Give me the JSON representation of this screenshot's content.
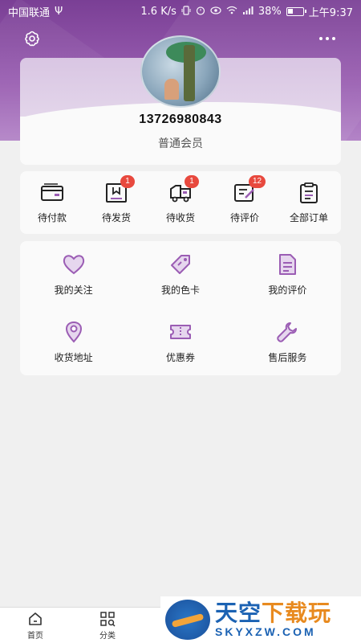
{
  "status_bar": {
    "carrier": "中国联通",
    "usb_symbol": "Ψ",
    "speed": "1.6 K/s",
    "battery_percent": "38%",
    "battery_level": 0.38,
    "time": "上午9:37"
  },
  "profile": {
    "phone": "13726980843",
    "member_level": "普通会员"
  },
  "orders": [
    {
      "label": "待付款",
      "badge": "",
      "icon": "wallet-icon"
    },
    {
      "label": "待发货",
      "badge": "1",
      "icon": "package-icon"
    },
    {
      "label": "待收货",
      "badge": "1",
      "icon": "truck-icon"
    },
    {
      "label": "待评价",
      "badge": "12",
      "icon": "review-icon"
    },
    {
      "label": "全部订单",
      "badge": "",
      "icon": "clipboard-icon"
    }
  ],
  "services": [
    {
      "label": "我的关注",
      "icon": "heart-icon"
    },
    {
      "label": "我的色卡",
      "icon": "tag-icon"
    },
    {
      "label": "我的评价",
      "icon": "document-icon"
    },
    {
      "label": "收货地址",
      "icon": "location-pin-icon"
    },
    {
      "label": "优惠券",
      "icon": "coupon-icon"
    },
    {
      "label": "售后服务",
      "icon": "wrench-icon"
    }
  ],
  "bottom_nav": {
    "home": "首页",
    "category": "分类"
  },
  "watermark": {
    "main_a": "天空",
    "main_b": "下载玩",
    "sub": "SKYXZW.COM"
  },
  "colors": {
    "accent": "#7a3f95",
    "icon": "#9b5db4",
    "badge": "#e8493e"
  }
}
